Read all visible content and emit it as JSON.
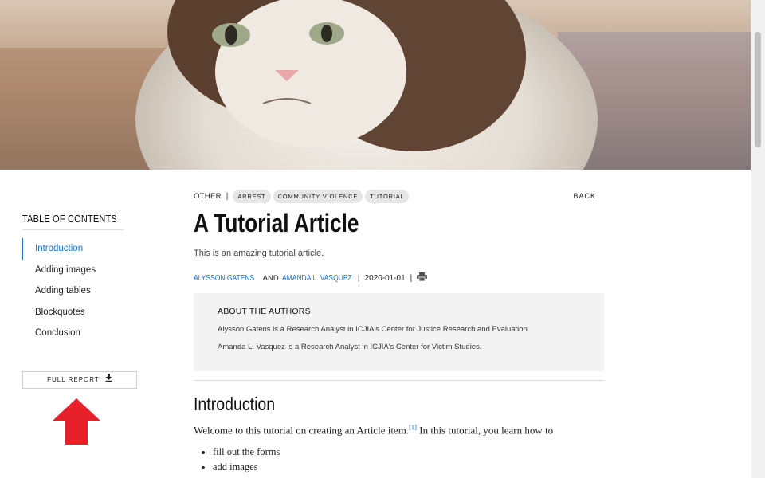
{
  "hero": {
    "alt": "grumpy cat photo"
  },
  "toc": {
    "title": "TABLE OF CONTENTS",
    "items": [
      {
        "label": "Introduction",
        "active": true
      },
      {
        "label": "Adding images"
      },
      {
        "label": "Adding tables"
      },
      {
        "label": "Blockquotes"
      },
      {
        "label": "Conclusion"
      }
    ],
    "full_report_label": "FULL REPORT"
  },
  "article": {
    "category": "OTHER",
    "separator": "|",
    "tags": [
      "ARREST",
      "COMMUNITY VIOLENCE",
      "TUTORIAL"
    ],
    "back_label": "BACK",
    "title": "A Tutorial Article",
    "summary": "This is an amazing tutorial article.",
    "authors": [
      "ALYSSON GATENS",
      "AMANDA L. VASQUEZ"
    ],
    "and_word": "AND",
    "date": "2020-01-01",
    "about_title": "ABOUT THE AUTHORS",
    "bios": [
      "Alysson Gatens is a Research Analyst in ICJIA's Center for Justice Research and Evaluation.",
      "Amanda L. Vasquez is a Research Analyst in ICJIA's Center for Victim Studies."
    ],
    "section_heading": "Introduction",
    "intro_before": "Welcome to this tutorial on creating an Article item.",
    "footnote": "[1]",
    "intro_after": " In this tutorial, you learn how to",
    "bullets": [
      "fill out the forms",
      "add images"
    ]
  },
  "colors": {
    "link": "#1a73c6",
    "arrow": "#e8202a",
    "box": "#f3f3f3"
  }
}
